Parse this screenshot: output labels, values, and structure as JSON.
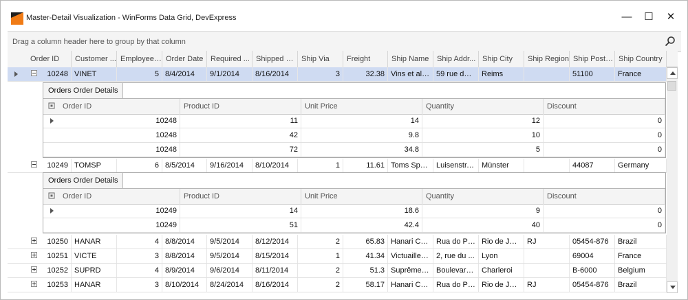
{
  "window": {
    "title": "Master-Detail Visualization - WinForms Data Grid, DevExpress",
    "minimize": "—",
    "maximize": "☐",
    "close": "✕"
  },
  "groupbar": {
    "text": "Drag a column header here to group by that column"
  },
  "columns": [
    "Order ID",
    "Customer ...",
    "Employee ...",
    "Order Date",
    "Required ...",
    "Shipped D...",
    "Ship Via",
    "Freight",
    "Ship Name",
    "Ship Addr...",
    "Ship City",
    "Ship Region",
    "Ship Posta...",
    "Ship Country"
  ],
  "rows": [
    {
      "cells": [
        "10248",
        "VINET",
        "5",
        "8/4/2014",
        "9/1/2014",
        "8/16/2014",
        "3",
        "32.38",
        "Vins et alc...",
        "59 rue de ...",
        "Reims",
        "",
        "51100",
        "France"
      ]
    },
    {
      "cells": [
        "10249",
        "TOMSP",
        "6",
        "8/5/2014",
        "9/16/2014",
        "8/10/2014",
        "1",
        "11.61",
        "Toms Spe...",
        "Luisenstr. ...",
        "Münster",
        "",
        "44087",
        "Germany"
      ]
    },
    {
      "cells": [
        "10250",
        "HANAR",
        "4",
        "8/8/2014",
        "9/5/2014",
        "8/12/2014",
        "2",
        "65.83",
        "Hanari Car...",
        "Rua do Pa...",
        "Rio de Jan...",
        "RJ",
        "05454-876",
        "Brazil"
      ]
    },
    {
      "cells": [
        "10251",
        "VICTE",
        "3",
        "8/8/2014",
        "9/5/2014",
        "8/15/2014",
        "1",
        "41.34",
        "Victuailles ...",
        "2, rue du ...",
        "Lyon",
        "",
        "69004",
        "France"
      ]
    },
    {
      "cells": [
        "10252",
        "SUPRD",
        "4",
        "8/9/2014",
        "9/6/2014",
        "8/11/2014",
        "2",
        "51.3",
        "Suprêmes ...",
        "Boulevard ...",
        "Charleroi",
        "",
        "B-6000",
        "Belgium"
      ]
    },
    {
      "cells": [
        "10253",
        "HANAR",
        "3",
        "8/10/2014",
        "8/24/2014",
        "8/16/2014",
        "2",
        "58.17",
        "Hanari Car...",
        "Rua do Pa...",
        "Rio de Jan...",
        "RJ",
        "05454-876",
        "Brazil"
      ]
    }
  ],
  "detail": {
    "tab_label": "Orders Order Details",
    "columns": [
      "Order ID",
      "Product ID",
      "Unit Price",
      "Quantity",
      "Discount"
    ],
    "sets": [
      [
        [
          "10248",
          "11",
          "14",
          "12",
          "0"
        ],
        [
          "10248",
          "42",
          "9.8",
          "10",
          "0"
        ],
        [
          "10248",
          "72",
          "34.8",
          "5",
          "0"
        ]
      ],
      [
        [
          "10249",
          "14",
          "18.6",
          "9",
          "0"
        ],
        [
          "10249",
          "51",
          "42.4",
          "40",
          "0"
        ]
      ]
    ]
  },
  "colors": {
    "selection": "#cfdbf2",
    "header": "#f4f4f4",
    "accent": "#f07b16"
  }
}
